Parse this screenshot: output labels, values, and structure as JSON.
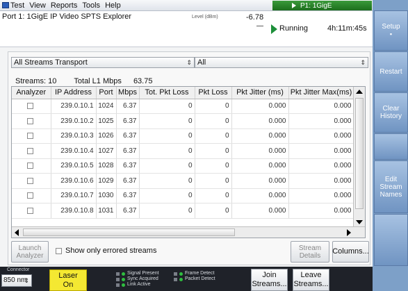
{
  "menu": {
    "items": [
      "Test",
      "View",
      "Reports",
      "Tools",
      "Help"
    ],
    "port_badge": "P1: 1GigE"
  },
  "status": {
    "title": "Port 1: 1GigE IP Video SPTS Explorer",
    "level_label": "Level (dBm)",
    "level_value": "-6.78",
    "level_sub": "—",
    "state": "Running",
    "elapsed": "4h:11m:45s"
  },
  "softkeys": {
    "setup": "Setup",
    "restart": "Restart",
    "clear_line1": "Clear",
    "clear_line2": "History",
    "edit_line1": "Edit",
    "edit_line2": "Stream",
    "edit_line3": "Names"
  },
  "filters": {
    "view_selected": "All Streams Transport",
    "stream_selected": "All"
  },
  "summary": {
    "streams_label": "Streams:",
    "streams_value": "10",
    "mbps_label": "Total L1 Mbps",
    "mbps_value": "63.75"
  },
  "table": {
    "columns": [
      "Analyzer",
      "IP Address",
      "Port",
      "Mbps",
      "Tot. Pkt Loss",
      "Pkt Loss",
      "Pkt Jitter (ms)",
      "Pkt Jitter Max(ms)"
    ],
    "rows": [
      {
        "ip": "239.0.10.1",
        "port": "1024",
        "mbps": "6.37",
        "tot_loss": "0",
        "loss": "0",
        "jitter": "0.000",
        "jitter_max": "0.000"
      },
      {
        "ip": "239.0.10.2",
        "port": "1025",
        "mbps": "6.37",
        "tot_loss": "0",
        "loss": "0",
        "jitter": "0.000",
        "jitter_max": "0.000"
      },
      {
        "ip": "239.0.10.3",
        "port": "1026",
        "mbps": "6.37",
        "tot_loss": "0",
        "loss": "0",
        "jitter": "0.000",
        "jitter_max": "0.000"
      },
      {
        "ip": "239.0.10.4",
        "port": "1027",
        "mbps": "6.37",
        "tot_loss": "0",
        "loss": "0",
        "jitter": "0.000",
        "jitter_max": "0.000"
      },
      {
        "ip": "239.0.10.5",
        "port": "1028",
        "mbps": "6.37",
        "tot_loss": "0",
        "loss": "0",
        "jitter": "0.000",
        "jitter_max": "0.000"
      },
      {
        "ip": "239.0.10.6",
        "port": "1029",
        "mbps": "6.37",
        "tot_loss": "0",
        "loss": "0",
        "jitter": "0.000",
        "jitter_max": "0.000"
      },
      {
        "ip": "239.0.10.7",
        "port": "1030",
        "mbps": "6.37",
        "tot_loss": "0",
        "loss": "0",
        "jitter": "0.000",
        "jitter_max": "0.000"
      },
      {
        "ip": "239.0.10.8",
        "port": "1031",
        "mbps": "6.37",
        "tot_loss": "0",
        "loss": "0",
        "jitter": "0.000",
        "jitter_max": "0.000"
      }
    ]
  },
  "controls": {
    "launch_line1": "Launch",
    "launch_line2": "Analyzer",
    "errored_only": "Show only errored streams",
    "details_line1": "Stream",
    "details_line2": "Details",
    "columns": "Columns..."
  },
  "bottom": {
    "connector_label": "Connector",
    "connector_value": "850 nm",
    "laser_line1": "Laser",
    "laser_line2": "On",
    "legend_signal": "Signal Present",
    "legend_sync": "Sync Acquired",
    "legend_link": "Link Active",
    "legend_frame": "Frame Detect",
    "legend_packet": "Packet Detect",
    "join_line1": "Join",
    "join_line2": "Streams...",
    "leave_line1": "Leave",
    "leave_line2": "Streams..."
  },
  "colors": {
    "running": "#1d8f3a",
    "softkey": "#7da0c8",
    "laser_on": "#f4e832",
    "led_green": "#2fbe3f"
  }
}
